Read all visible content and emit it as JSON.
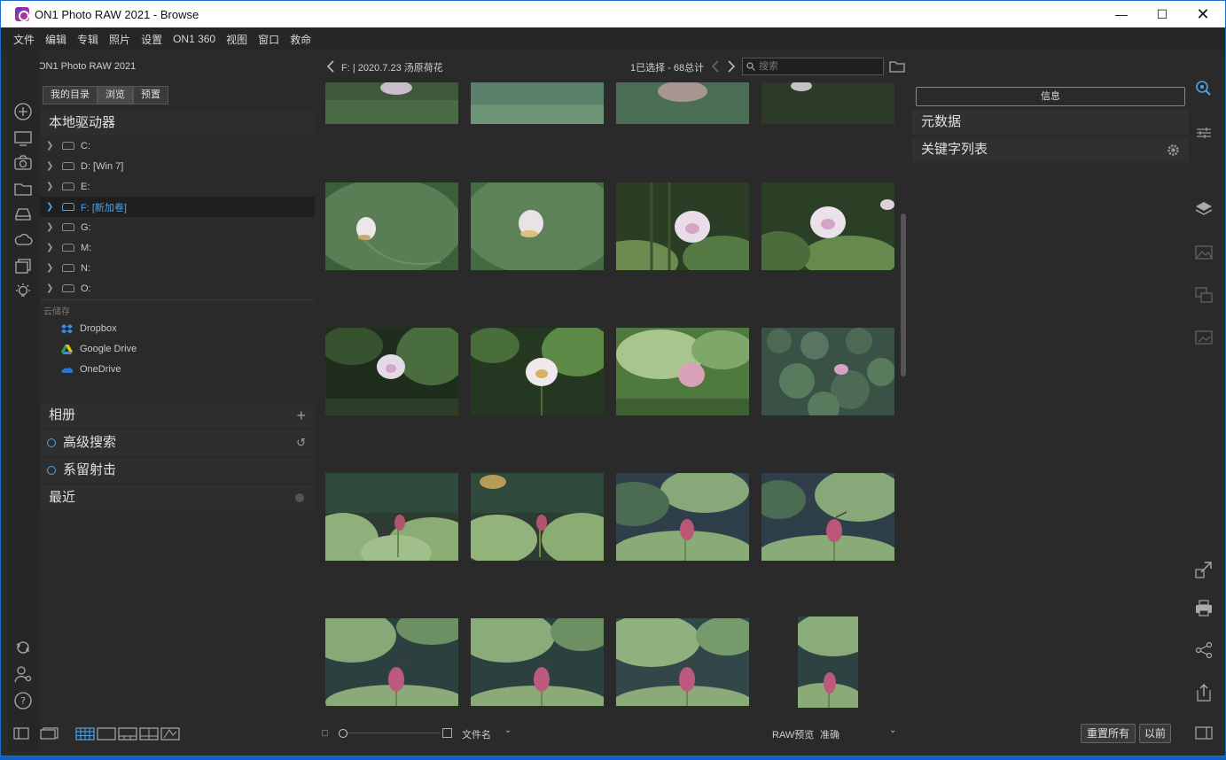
{
  "window": {
    "title": "ON1 Photo RAW 2021 - Browse"
  },
  "menu": [
    "文件",
    "编辑",
    "专辑",
    "照片",
    "设置",
    "ON1 360",
    "视图",
    "窗口",
    "救命"
  ],
  "brand": {
    "name": "ON1 Photo RAW 2021"
  },
  "left_tabs": [
    "我的目录",
    "浏览",
    "预置"
  ],
  "local_drives": {
    "title": "本地驱动器",
    "drives": [
      "C:",
      "D: [Win 7]",
      "E:",
      "F: [新加卷]",
      "G:",
      "M:",
      "N:",
      "O:"
    ]
  },
  "cloud": {
    "label": "云储存",
    "services": [
      "Dropbox",
      "Google Drive",
      "OneDrive"
    ]
  },
  "sections": {
    "albums": "相册",
    "advanced_search": "高级搜索",
    "keep_shot": "系留射击",
    "recent": "最近"
  },
  "header": {
    "path": "F: | 2020.7.23 汤原荷花",
    "count": "1已选择 - 68总计",
    "search_placeholder": "搜索"
  },
  "right": {
    "info_button": "信息",
    "metadata": "元数据",
    "keyword_list": "关键字列表",
    "reset_all": "重置所有",
    "previous": "以前"
  },
  "bottom": {
    "sort_label": "文件名",
    "raw_label": "RAW预览",
    "raw_value": "准确"
  },
  "colors": {
    "accent": "#4ea3e8",
    "bg": "#2a2a2a",
    "panel": "#2e2e2e"
  }
}
